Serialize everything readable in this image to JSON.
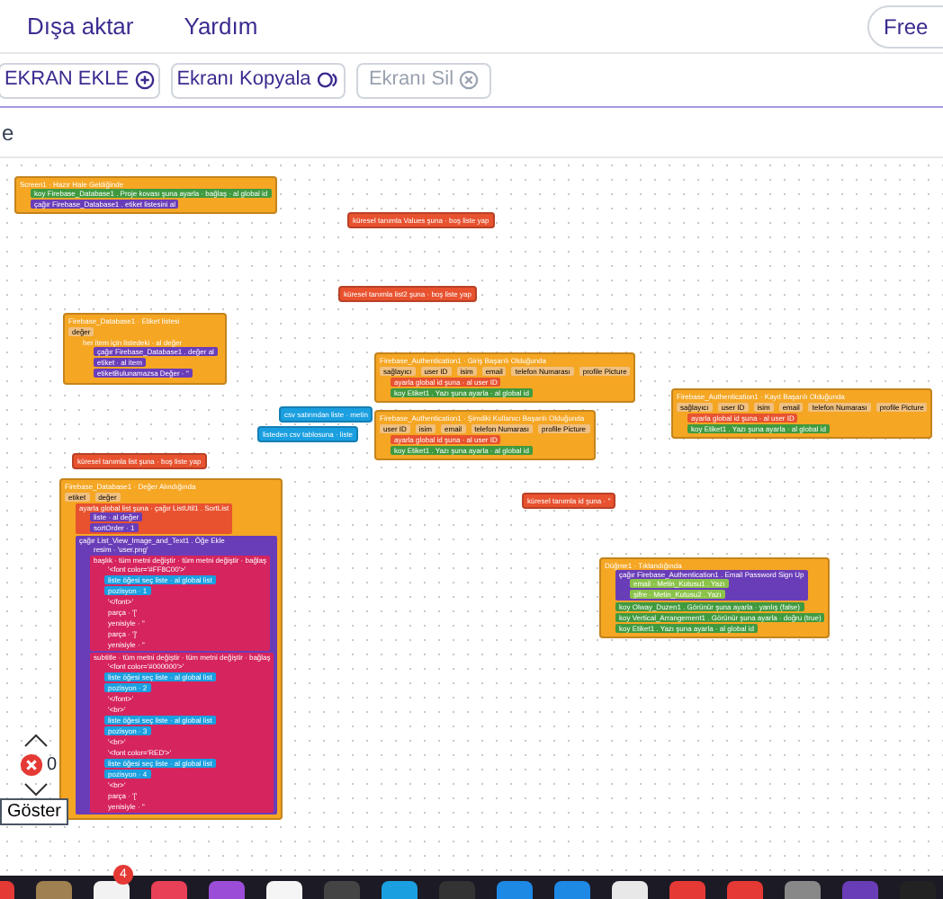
{
  "menu": [
    {
      "label": "Dışa aktar"
    },
    {
      "label": "Yardım"
    }
  ],
  "plan_button": {
    "label": "Free"
  },
  "toolbar": [
    {
      "label": "EKRAN EKLE",
      "kind": "add",
      "disabled": false
    },
    {
      "label": "Ekranı Kopyala",
      "kind": "copy",
      "disabled": false
    },
    {
      "label": "Ekranı Sil",
      "kind": "delete",
      "disabled": true
    }
  ],
  "subbar": {
    "text": "e"
  },
  "blocks": [
    {
      "color": "#f5a623",
      "text": "Screen1 · Hazır Hale Geldiğinde",
      "children": [
        {
          "color": "#3f9a3f",
          "text": "koy Firebase_Database1 . Proje kovası şuna ayarla · bağlaş · al global id"
        },
        {
          "color": "#6a3db8",
          "text": "çağır Firebase_Database1 . etiket listesini al"
        }
      ]
    },
    {
      "color": "#e8522f",
      "text": "küresel tanımla Values şuna · boş liste yap"
    },
    {
      "color": "#e8522f",
      "text": "küresel tanımla list2 şuna · boş liste yap"
    },
    {
      "color": "#f5a623",
      "text": "Firebase_Database1 · Etiket listesi",
      "params": [
        "değer"
      ],
      "children": [
        {
          "color": "#f5a623",
          "text": "her item için listedeki · al değer",
          "children": [
            {
              "color": "#6a3db8",
              "text": "çağır Firebase_Database1 . değer al"
            },
            {
              "color": "#6a3db8",
              "text": "etiket · al item"
            },
            {
              "color": "#6a3db8",
              "text": "etiketBulunamazsa Değer · ''"
            }
          ]
        }
      ]
    },
    {
      "color": "#1a9fe0",
      "text": "csv satırından liste · metin"
    },
    {
      "color": "#1a9fe0",
      "text": "listeden csv tablosuna · liste"
    },
    {
      "color": "#e8522f",
      "text": "küresel tanımla list şuna · boş liste yap"
    },
    {
      "color": "#f5a623",
      "text": "Firebase_Authentication1 · Giriş Başarılı Olduğunda",
      "params": [
        "sağlayıcı",
        "user ID",
        "isim",
        "email",
        "telefon Numarası",
        "profile Picture"
      ],
      "children": [
        {
          "color": "#e8522f",
          "text": "ayarla global id şuna · al user ID"
        },
        {
          "color": "#3f9a3f",
          "text": "koy Etiket1 . Yazı şuna ayarla · al global id"
        }
      ]
    },
    {
      "color": "#f5a623",
      "text": "Firebase_Authentication1 · Şimdiki Kullanıcı Başarılı Olduğunda",
      "params": [
        "user ID",
        "isim",
        "email",
        "telefon Numarası",
        "profile Picture"
      ],
      "children": [
        {
          "color": "#e8522f",
          "text": "ayarla global id şuna · al user ID"
        },
        {
          "color": "#3f9a3f",
          "text": "koy Etiket1 . Yazı şuna ayarla · al global id"
        }
      ]
    },
    {
      "color": "#f5a623",
      "text": "Firebase_Authentication1 · Kayıt Başarılı Olduğunda",
      "params": [
        "sağlayıcı",
        "user ID",
        "isim",
        "email",
        "telefon Numarası",
        "profile Picture"
      ],
      "children": [
        {
          "color": "#e8522f",
          "text": "ayarla global id şuna · al user ID"
        },
        {
          "color": "#3f9a3f",
          "text": "koy Etiket1 . Yazı şuna ayarla · al global id"
        }
      ]
    },
    {
      "color": "#f5a623",
      "text": "Firebase_Database1 · Değer Alındığında",
      "params": [
        "etiket",
        "değer"
      ],
      "children": [
        {
          "color": "#e8522f",
          "text": "ayarla global list şuna · çağır ListUtil1 . SortList",
          "children": [
            {
              "color": "#6a3db8",
              "text": "liste · al değer"
            },
            {
              "color": "#6a3db8",
              "text": "sortOrder · 1"
            }
          ]
        },
        {
          "color": "#6a3db8",
          "text": "çağır List_View_Image_and_Text1 . Öğe Ekle",
          "children": [
            {
              "color": "#6a3db8",
              "text": "resim · 'user.png'"
            },
            {
              "color": "#d6245e",
              "text": "başlık · tüm metni değiştir · tüm metni değiştir · bağlaş",
              "children": [
                {
                  "color": "#d6245e",
                  "text": "'<font color='#FF8C00'>'"
                },
                {
                  "color": "#1a9fe0",
                  "text": "liste öğesi seç liste · al global list"
                },
                {
                  "color": "#1a9fe0",
                  "text": "pozisyon · 1"
                },
                {
                  "color": "#d6245e",
                  "text": "'</font>'"
                },
                {
                  "color": "#d6245e",
                  "text": "parça · '['"
                },
                {
                  "color": "#d6245e",
                  "text": "yenisiyle · ''"
                },
                {
                  "color": "#d6245e",
                  "text": "parça · ']'"
                },
                {
                  "color": "#d6245e",
                  "text": "yenisiyle · ''"
                }
              ]
            },
            {
              "color": "#d6245e",
              "text": "subtitle · tüm metni değiştir · tüm metni değiştir · bağlaş",
              "children": [
                {
                  "color": "#d6245e",
                  "text": "'<font color='#000000'>'"
                },
                {
                  "color": "#1a9fe0",
                  "text": "liste öğesi seç liste · al global list"
                },
                {
                  "color": "#1a9fe0",
                  "text": "pozisyon · 2"
                },
                {
                  "color": "#d6245e",
                  "text": "'</font>'"
                },
                {
                  "color": "#d6245e",
                  "text": "'<br>'"
                },
                {
                  "color": "#1a9fe0",
                  "text": "liste öğesi seç liste · al global list"
                },
                {
                  "color": "#1a9fe0",
                  "text": "pozisyon · 3"
                },
                {
                  "color": "#d6245e",
                  "text": "'<br>'"
                },
                {
                  "color": "#d6245e",
                  "text": "'<font color='RED'>'"
                },
                {
                  "color": "#1a9fe0",
                  "text": "liste öğesi seç liste · al global list"
                },
                {
                  "color": "#1a9fe0",
                  "text": "pozisyon · 4"
                },
                {
                  "color": "#d6245e",
                  "text": "'<br>'"
                },
                {
                  "color": "#d6245e",
                  "text": "parça · '['"
                },
                {
                  "color": "#d6245e",
                  "text": "yenisiyle · ''"
                }
              ]
            }
          ]
        }
      ]
    },
    {
      "color": "#e8522f",
      "text": "küresel tanımla id şuna · ''"
    },
    {
      "color": "#f5a623",
      "text": "Düğme1 · Tıklandığında",
      "children": [
        {
          "color": "#6a3db8",
          "text": "çağır Firebase_Authentication1 . Email Password Sign Up",
          "children": [
            {
              "color": "#8bc34a",
              "text": "email · Metin_Kutusu1 . Yazı"
            },
            {
              "color": "#8bc34a",
              "text": "şifre · Metin_Kutusu2 . Yazı"
            }
          ]
        },
        {
          "color": "#3f9a3f",
          "text": "koy Olway_Duzen1 . Görünür şuna ayarla · yanlış (false)"
        },
        {
          "color": "#3f9a3f",
          "text": "koy Vertical_Arrangement1 . Görünür şuna ayarla · doğru (true)"
        },
        {
          "color": "#3f9a3f",
          "text": "koy Etiket1 . Yazı şuna ayarla · al global id"
        }
      ]
    }
  ],
  "workspace": {
    "warnings": "0",
    "show_button": "Göster"
  },
  "dock": {
    "badge": "4"
  }
}
